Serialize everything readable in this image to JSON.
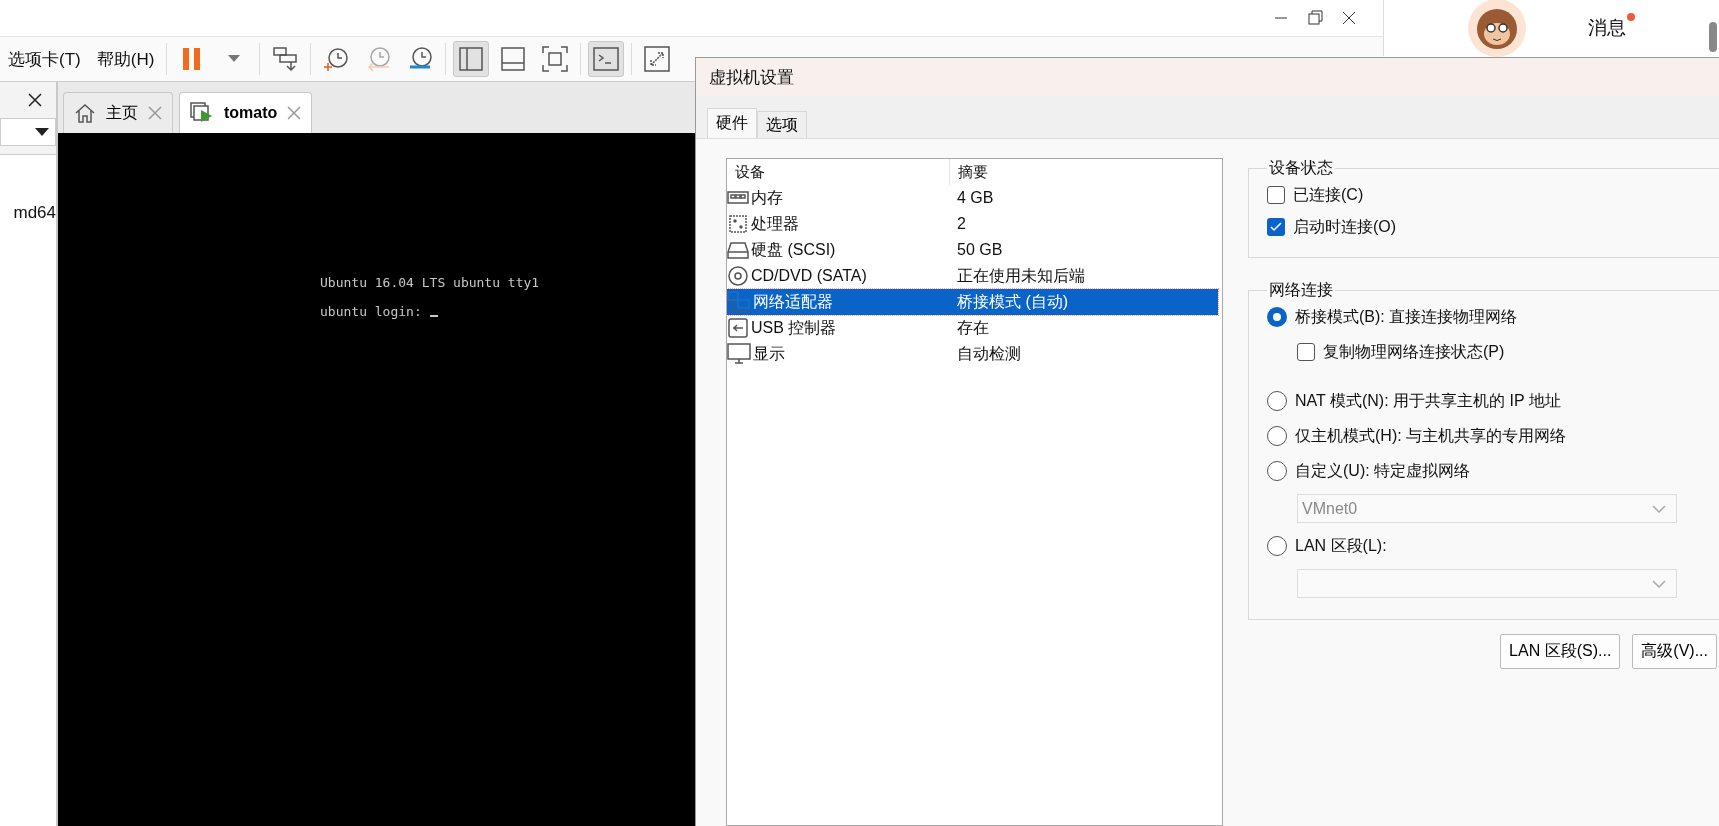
{
  "main_window": {
    "menu": [
      {
        "label": "选项卡(T)"
      },
      {
        "label": "帮助(H)"
      }
    ],
    "toolbar": [
      {
        "kind": "pause",
        "pressed": false,
        "disabled": false
      },
      {
        "kind": "caret",
        "pressed": false,
        "disabled": false
      },
      {
        "kind": "send-keys",
        "pressed": false,
        "disabled": false
      },
      {
        "kind": "snapshot-take",
        "pressed": false,
        "disabled": false
      },
      {
        "kind": "snapshot-revert",
        "pressed": false,
        "disabled": true
      },
      {
        "kind": "snapshot-manage",
        "pressed": false,
        "disabled": false
      },
      {
        "kind": "view-library",
        "pressed": true,
        "disabled": false
      },
      {
        "kind": "view-thumbnail",
        "pressed": false,
        "disabled": false
      },
      {
        "kind": "view-fullscreen",
        "pressed": false,
        "disabled": false
      },
      {
        "kind": "console",
        "pressed": true,
        "disabled": false
      },
      {
        "kind": "stretch",
        "pressed": false,
        "disabled": false
      }
    ],
    "library": {
      "items": [
        "md64"
      ]
    },
    "tabs": [
      {
        "kind": "home",
        "label": "主页",
        "selected": false
      },
      {
        "kind": "vm",
        "label": "tomato",
        "selected": true
      }
    ],
    "console": {
      "lines": [
        "Ubuntu 16.04 LTS ubuntu tty1",
        "ubuntu login:"
      ]
    }
  },
  "header": {
    "message": "消息",
    "unread": true
  },
  "dialog": {
    "title": "虚拟机设置",
    "tabs": [
      {
        "label": "硬件",
        "selected": true
      },
      {
        "label": "选项",
        "selected": false
      }
    ],
    "device_table": {
      "columns": [
        "设备",
        "摘要"
      ],
      "rows": [
        {
          "kind": "memory",
          "device": "内存",
          "summary": "4 GB",
          "selected": false
        },
        {
          "kind": "cpu",
          "device": "处理器",
          "summary": "2",
          "selected": false
        },
        {
          "kind": "disk",
          "device": "硬盘 (SCSI)",
          "summary": "50 GB",
          "selected": false
        },
        {
          "kind": "cd",
          "device": "CD/DVD (SATA)",
          "summary": "正在使用未知后端",
          "selected": false
        },
        {
          "kind": "network",
          "device": "网络适配器",
          "summary": "桥接模式 (自动)",
          "selected": true
        },
        {
          "kind": "usb",
          "device": "USB 控制器",
          "summary": "存在",
          "selected": false
        },
        {
          "kind": "display",
          "device": "显示",
          "summary": "自动检测",
          "selected": false
        }
      ]
    },
    "device_status": {
      "title": "设备状态",
      "options": [
        {
          "label": "已连接(C)",
          "checked": false
        },
        {
          "label": "启动时连接(O)",
          "checked": true
        }
      ]
    },
    "network": {
      "title": "网络连接",
      "options": [
        {
          "kind": "radio",
          "label": "桥接模式(B): 直接连接物理网络",
          "selected": true
        },
        {
          "kind": "checkbox",
          "label": "复制物理网络连接状态(P)",
          "checked": false
        },
        {
          "kind": "radio",
          "label": "NAT 模式(N): 用于共享主机的 IP 地址",
          "selected": false
        },
        {
          "kind": "radio",
          "label": "仅主机模式(H): 与主机共享的专用网络",
          "selected": false
        },
        {
          "kind": "radio",
          "label": "自定义(U): 特定虚拟网络",
          "selected": false
        },
        {
          "kind": "select",
          "value": "VMnet0",
          "disabled": true
        },
        {
          "kind": "radio",
          "label": "LAN 区段(L):",
          "selected": false
        },
        {
          "kind": "select",
          "disabled": true
        }
      ]
    },
    "buttons": [
      {
        "label": "LAN 区段(S)..."
      },
      {
        "label": "高级(V)..."
      }
    ]
  }
}
